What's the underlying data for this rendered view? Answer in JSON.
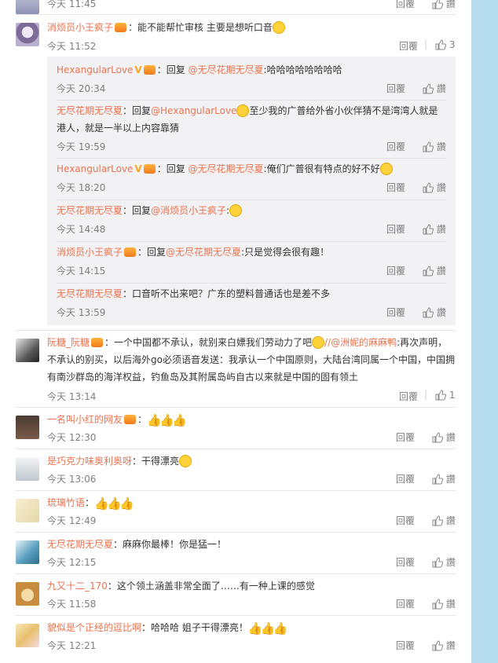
{
  "labels": {
    "reply": "回覆",
    "like_word": "讚"
  },
  "top_partial": {
    "time": "今天 11:45"
  },
  "main_comment": {
    "name": "消烦员小王疯子",
    "text": "：能不能帮忙审核 主要是想听口音",
    "time": "今天 11:52",
    "likes": "3"
  },
  "replies": [
    {
      "name": "HexangularLove",
      "verified": "V",
      "prefix": "：回复 ",
      "mention": "@无尽花期无尽夏",
      "text": ":哈哈哈哈哈哈哈哈",
      "time": "今天 20:34"
    },
    {
      "name": "无尽花期无尽夏",
      "prefix": "：回复",
      "mention": "@HexangularLove",
      "text": "至少我的广普给外省小伙伴猜不是湾湾人就是港人，就是一半以上内容靠猜",
      "time": "今天 19:59"
    },
    {
      "name": "HexangularLove",
      "verified": "V",
      "prefix": "：回复 ",
      "mention": "@无尽花期无尽夏",
      "text": ":俺们广普很有特点的好不好",
      "time": "今天 18:20"
    },
    {
      "name": "无尽花期无尽夏",
      "prefix": "：回复",
      "mention": "@消烦员小王疯子",
      "text": ":",
      "time": "今天 14:48"
    },
    {
      "name": "消烦员小王疯子",
      "prefix": "：回复",
      "mention": "@无尽花期无尽夏",
      "text": ":只是觉得会很有趣！",
      "time": "今天 14:15"
    },
    {
      "name": "无尽花期无尽夏",
      "prefix": "：",
      "mention": "",
      "text": "口音听不出来吧？广东的塑料普通话也是差不多",
      "time": "今天 13:59"
    }
  ],
  "comments": [
    {
      "name": "阮糖_阮糖",
      "pre": "：一个中国都不承认，就别来白嫖我们劳动力了吧",
      "mention": "//@洲妮的麻麻鸭",
      "post": ":再次声明，不承认的别买，以后海外go必须语音发送：我承认一个中国原则，大陆台湾同属一个中国，中国拥有南沙群岛的海洋权益，钓鱼岛及其附属岛屿自古以来就是中国的固有领土",
      "time": "今天 13:14",
      "likes": "1"
    },
    {
      "name": "一名叫小红的网友",
      "text": "：",
      "time": "今天 12:30"
    },
    {
      "name": "是巧克力味奥利奥呀",
      "text": "：干得漂亮",
      "time": "今天 13:06"
    },
    {
      "name": "琉璃竹语",
      "text": "：",
      "time": "今天 12:49"
    },
    {
      "name": "无尽花期无尽夏",
      "text": "：麻麻你最棒！你是猛一！",
      "time": "今天 12:15"
    },
    {
      "name": "九又十二_170",
      "text": "：这个领土涵盖非常全面了……有一种上课的感觉",
      "time": "今天 11:58"
    },
    {
      "name": "貌似是个正经的逗比啊",
      "text": "：哈哈哈 姐子干得漂亮！",
      "time": "今天 12:21"
    }
  ]
}
